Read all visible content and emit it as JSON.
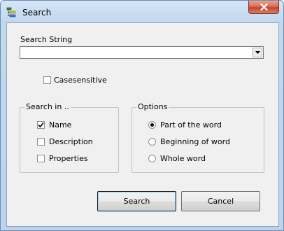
{
  "window": {
    "title": "Search"
  },
  "search_string": {
    "label": "Search String",
    "value": ""
  },
  "casesensitive": {
    "label": "Casesensitive",
    "checked": false
  },
  "search_in": {
    "title": "Search in ..",
    "items": [
      {
        "label": "Name",
        "checked": true
      },
      {
        "label": "Description",
        "checked": false
      },
      {
        "label": "Properties",
        "checked": false
      }
    ]
  },
  "options": {
    "title": "Options",
    "items": [
      {
        "label": "Part of the word",
        "selected": true
      },
      {
        "label": "Beginning of word",
        "selected": false
      },
      {
        "label": "Whole word",
        "selected": false
      }
    ]
  },
  "buttons": {
    "search": "Search",
    "cancel": "Cancel"
  },
  "colors": {
    "close_button": "#c4452b",
    "title_bar": "#c2d8ef"
  }
}
